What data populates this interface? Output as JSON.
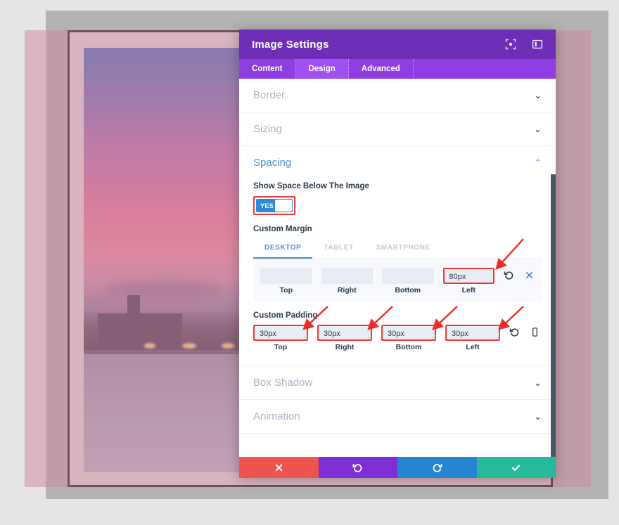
{
  "canvas": {
    "background_color": "#e5e5e5",
    "gray_band_color": "#b3b3b3",
    "pink_overlay_color": "rgba(206,136,158,.52)",
    "document_border_color": "#111111",
    "document_fill_color": "#e3e3e3",
    "photo_description": "city skyline at sunset with pink and purple sky, illuminated buildings and a bridge over frozen water"
  },
  "modal": {
    "title": "Image Settings",
    "header_icons": [
      {
        "name": "fullscreen-icon",
        "glyph": "expand"
      },
      {
        "name": "layout-panel-icon",
        "glyph": "panel"
      }
    ],
    "tabs": [
      {
        "label": "Content",
        "active": false
      },
      {
        "label": "Design",
        "active": true
      },
      {
        "label": "Advanced",
        "active": false
      }
    ],
    "sections": [
      {
        "title": "Border",
        "open": false,
        "chevron": "⌄"
      },
      {
        "title": "Sizing",
        "open": false,
        "chevron": "⌄"
      },
      {
        "title": "Spacing",
        "open": true,
        "chevron": "⌃"
      },
      {
        "title": "Box Shadow",
        "open": false,
        "chevron": "⌄"
      },
      {
        "title": "Animation",
        "open": false,
        "chevron": "⌄"
      }
    ],
    "spacing": {
      "show_space_label": "Show Space Below The Image",
      "toggle": {
        "value": "YES",
        "on": true,
        "highlighted": true,
        "color": "#2d8ad6"
      },
      "custom_margin_label": "Custom Margin",
      "device_tabs": [
        {
          "label": "DESKTOP",
          "active": true
        },
        {
          "label": "TABLET",
          "active": false
        },
        {
          "label": "SMARTPHONE",
          "active": false
        }
      ],
      "margin_fields": [
        {
          "caption": "Top",
          "value": "",
          "placeholder": "",
          "highlighted": false
        },
        {
          "caption": "Right",
          "value": "",
          "placeholder": "",
          "highlighted": false
        },
        {
          "caption": "Bottom",
          "value": "",
          "placeholder": "",
          "highlighted": false
        },
        {
          "caption": "Left",
          "value": "80px",
          "placeholder": "",
          "highlighted": true
        }
      ],
      "margin_icons": [
        {
          "name": "reset-icon",
          "glyph": "undo"
        },
        {
          "name": "clear-icon",
          "glyph": "x"
        }
      ],
      "custom_padding_label": "Custom Padding",
      "padding_fields": [
        {
          "caption": "Top",
          "value": "30px",
          "highlighted": true
        },
        {
          "caption": "Right",
          "value": "30px",
          "highlighted": true
        },
        {
          "caption": "Bottom",
          "value": "30px",
          "highlighted": true
        },
        {
          "caption": "Left",
          "value": "30px",
          "highlighted": true
        }
      ],
      "padding_icons": [
        {
          "name": "reset-icon",
          "glyph": "undo"
        },
        {
          "name": "mobile-device-icon",
          "glyph": "phone"
        }
      ]
    },
    "footer_buttons": [
      {
        "name": "cancel-button",
        "glyph": "✖",
        "color": "#ef5350"
      },
      {
        "name": "undo-button",
        "glyph": "undo",
        "color": "#7b2fd4"
      },
      {
        "name": "redo-button",
        "glyph": "redo",
        "color": "#2585d1"
      },
      {
        "name": "save-button",
        "glyph": "✔",
        "color": "#26b99a"
      }
    ],
    "scrollbar": {
      "color": "#4a5568"
    }
  },
  "annotations": {
    "arrow_color": "#ee2b26",
    "highlight_color": "#ef3b36",
    "arrows": 5
  }
}
